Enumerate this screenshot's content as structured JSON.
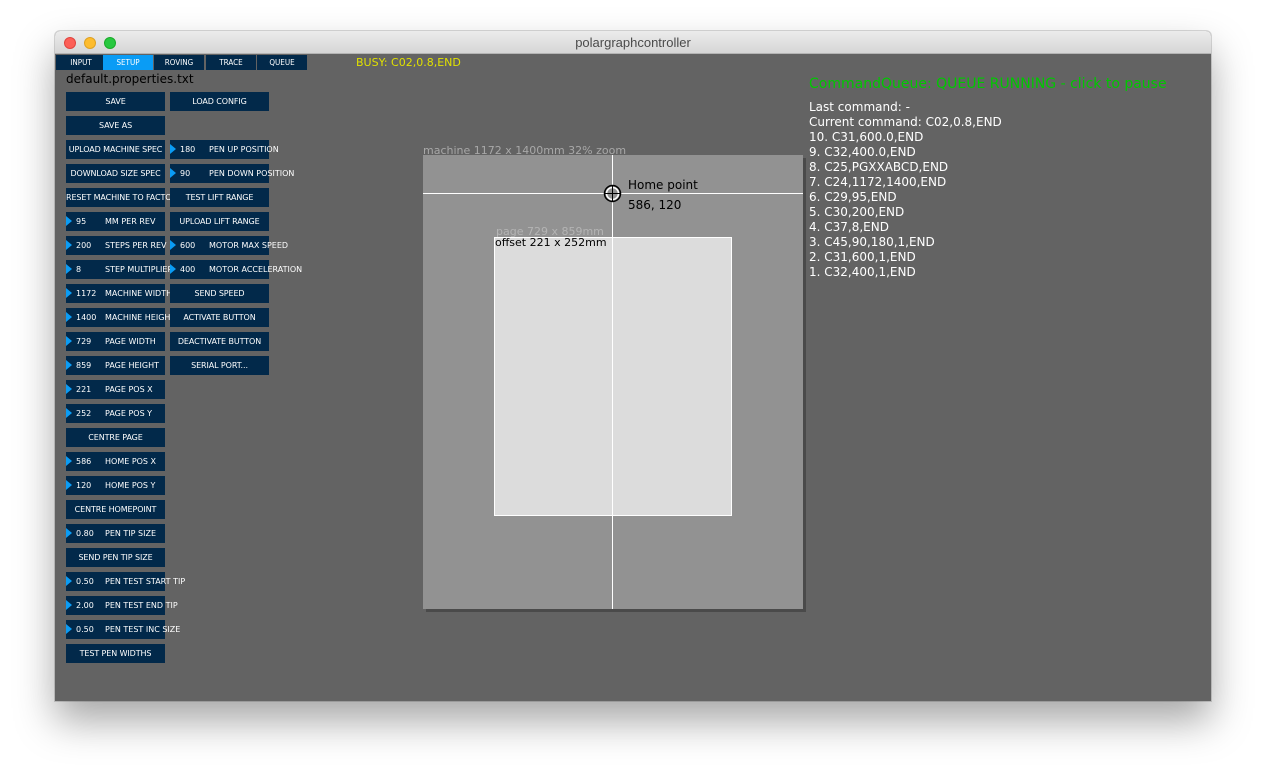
{
  "window": {
    "title": "polargraphcontroller"
  },
  "tabs": [
    "INPUT",
    "SETUP",
    "ROVING",
    "TRACE",
    "QUEUE"
  ],
  "active_tab": "SETUP",
  "busy_status": "BUSY: C02,0.8,END",
  "properties_file": "default.properties.txt",
  "left_column": {
    "save": "SAVE",
    "save_as": "SAVE AS",
    "upload_machine_spec": "UPLOAD MACHINE SPEC",
    "download_size_spec": "DOWNLOAD SIZE SPEC",
    "reset_machine": "RESET MACHINE TO FACTORY",
    "mm_per_rev": {
      "value": "95",
      "label": "MM PER REV"
    },
    "steps_per_rev": {
      "value": "200",
      "label": "STEPS PER REV"
    },
    "step_multiplier": {
      "value": "8",
      "label": "STEP MULTIPLIER"
    },
    "machine_width": {
      "value": "1172",
      "label": "MACHINE WIDTH"
    },
    "machine_height": {
      "value": "1400",
      "label": "MACHINE HEIGHT"
    },
    "page_width": {
      "value": "729",
      "label": "PAGE WIDTH"
    },
    "page_height": {
      "value": "859",
      "label": "PAGE HEIGHT"
    },
    "page_pos_x": {
      "value": "221",
      "label": "PAGE POS X"
    },
    "page_pos_y": {
      "value": "252",
      "label": "PAGE POS Y"
    },
    "centre_page": "CENTRE PAGE",
    "home_pos_x": {
      "value": "586",
      "label": "HOME POS X"
    },
    "home_pos_y": {
      "value": "120",
      "label": "HOME POS Y"
    },
    "centre_homepoint": "CENTRE HOMEPOINT",
    "pen_tip_size": {
      "value": "0.80",
      "label": "PEN TIP SIZE"
    },
    "send_pen_tip_size": "SEND PEN TIP SIZE",
    "pen_test_start_tip": {
      "value": "0.50",
      "label": "PEN TEST START TIP"
    },
    "pen_test_end_tip": {
      "value": "2.00",
      "label": "PEN TEST END TIP"
    },
    "pen_test_inc_size": {
      "value": "0.50",
      "label": "PEN TEST INC SIZE"
    },
    "test_pen_widths": "TEST PEN WIDTHS"
  },
  "right_column": {
    "load_config": "LOAD CONFIG",
    "pen_up_position": {
      "value": "180",
      "label": "PEN UP POSITION"
    },
    "pen_down_position": {
      "value": "90",
      "label": "PEN DOWN POSITION"
    },
    "test_lift_range": "TEST LIFT RANGE",
    "upload_lift_range": "UPLOAD LIFT RANGE",
    "motor_max_speed": {
      "value": "600",
      "label": "MOTOR MAX SPEED"
    },
    "motor_acceleration": {
      "value": "400",
      "label": "MOTOR ACCELERATION"
    },
    "send_speed": "SEND SPEED",
    "activate_button": "ACTIVATE BUTTON",
    "deactivate_button": "DEACTIVATE BUTTON",
    "serial_port": "SERIAL PORT..."
  },
  "canvas": {
    "machine_label": "machine 1172 x 1400mm 32% zoom",
    "page_label": "page 729 x 859mm",
    "offset_label": "offset 221 x 252mm",
    "home_label": "Home point",
    "home_coords": "586, 120"
  },
  "queue": {
    "status": "CommandQueue: QUEUE RUNNING - click to pause",
    "last_command": "Last command: -",
    "current_command": "Current command: C02,0.8,END",
    "items": [
      "10. C31,600.0,END",
      "9. C32,400.0,END",
      "8. C25,PGXXABCD,END",
      "7. C24,1172,1400,END",
      "6. C29,95,END",
      "5. C30,200,END",
      "4. C37,8,END",
      "3. C45,90,180,1,END",
      "2. C31,600,1,END",
      "1. C32,400,1,END"
    ]
  },
  "colors": {
    "background": "#636363",
    "button": "#02294a",
    "active_tab": "#0a9cf5",
    "busy_text": "#e1e100",
    "queue_status": "#00c800",
    "machine_area": "#929292",
    "page_area": "#dcdcdc"
  }
}
